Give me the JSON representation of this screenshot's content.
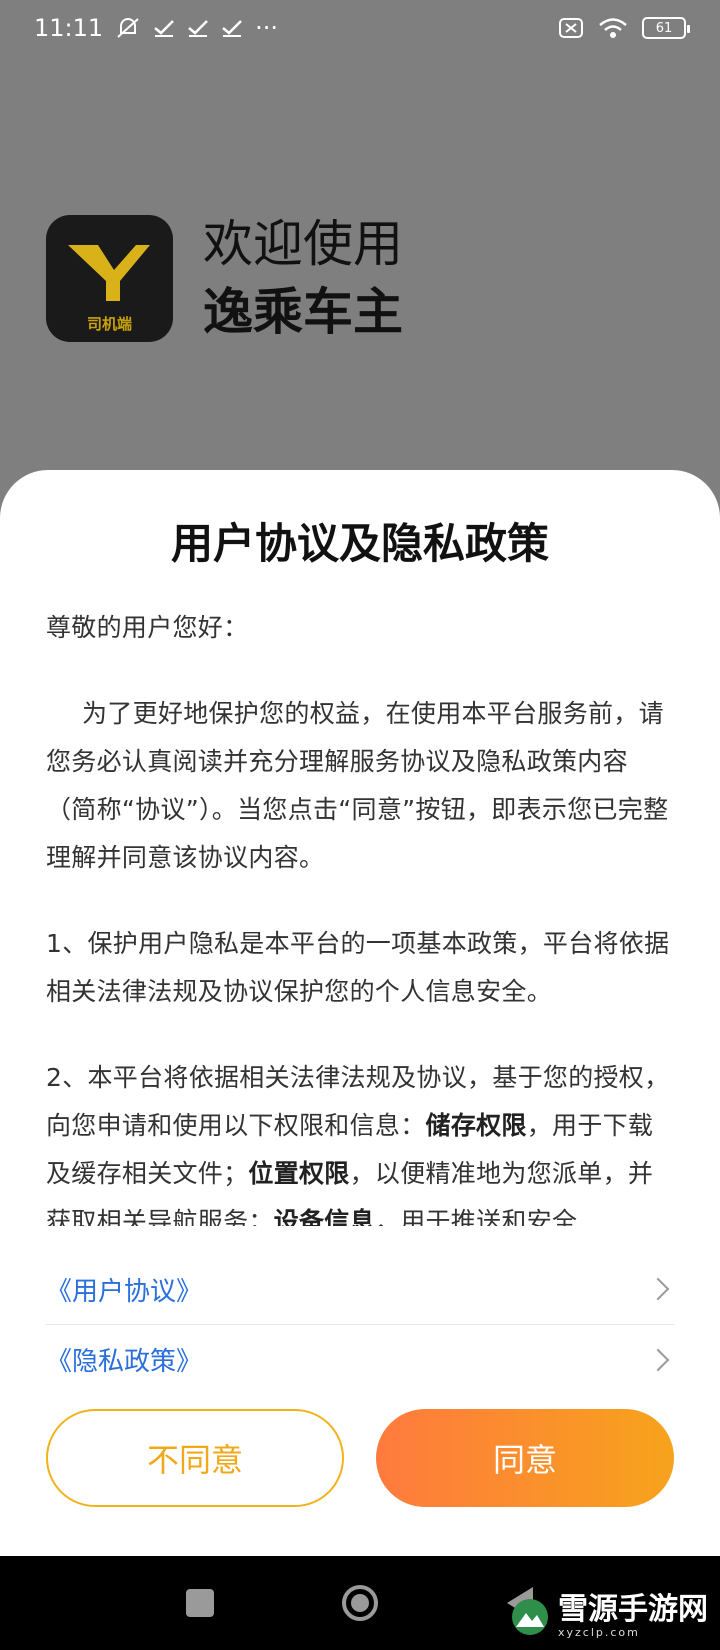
{
  "status_bar": {
    "time": "11:11",
    "more": "···",
    "battery": "61"
  },
  "app": {
    "logo_sub_label": "司机端",
    "welcome_line1": "欢迎使用",
    "welcome_line2": "逸乘车主"
  },
  "dialog": {
    "title": "用户协议及隐私政策",
    "greeting": "尊敬的用户您好：",
    "para1": "为了更好地保护您的权益，在使用本平台服务前，请您务必认真阅读并充分理解服务协议及隐私政策内容（简称“协议”）。当您点击“同意”按钮，即表示您已完整理解并同意该协议内容。",
    "para2": "1、保护用户隐私是本平台的一项基本政策，平台将依据相关法律法规及协议保护您的个人信息安全。",
    "para3_a": "2、本平台将依据相关法律法规及协议，基于您的授权，向您申请和使用以下权限和信息：",
    "para3_b1": "储存权限",
    "para3_c": "，用于下载及缓存相关文件；",
    "para3_b2": "位置权限",
    "para3_d": "，以便精准地为您派单，并获取相关导航服务；",
    "para3_b3": "设备信息",
    "para3_e": "，用于推送和安全",
    "links": [
      {
        "label": "《用户协议》"
      },
      {
        "label": "《隐私政策》"
      }
    ],
    "disagree_label": "不同意",
    "agree_label": "同意"
  },
  "watermark": {
    "text": "雪源手游网",
    "sub": "xyzclp.com"
  },
  "colors": {
    "accent_orange": "#f7a31c",
    "link_blue": "#2a6fdb",
    "gradient_start": "#ff7a3e"
  }
}
